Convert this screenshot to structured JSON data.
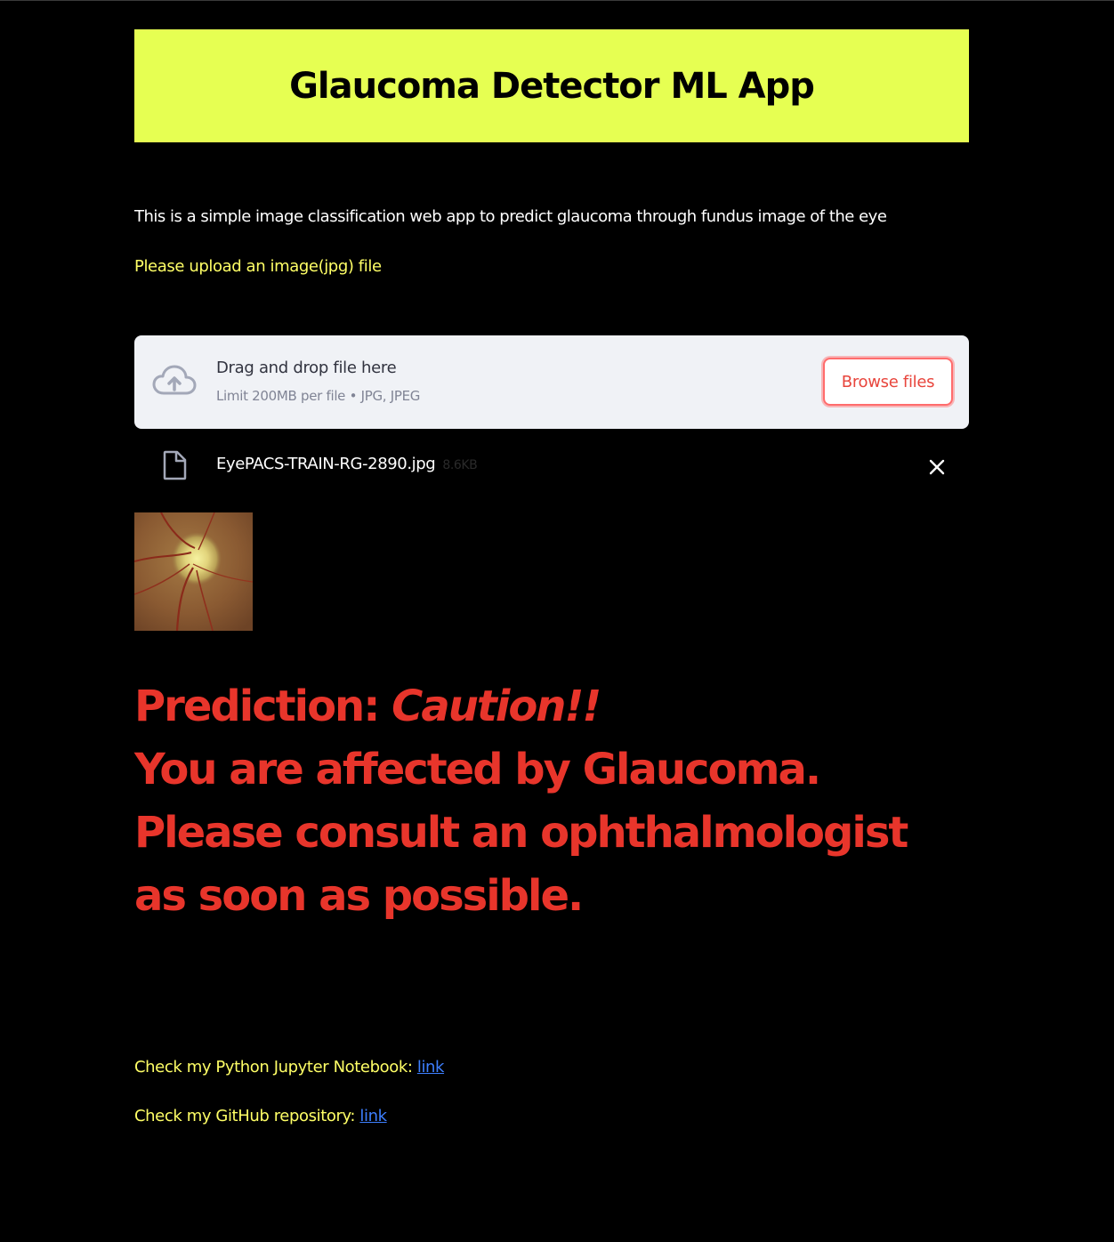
{
  "header": {
    "title": "Glaucoma Detector ML App"
  },
  "intro": {
    "text": "This is a simple image classification web app to predict glaucoma through fundus image of the eye"
  },
  "upload": {
    "prompt": "Please upload an image(jpg) file",
    "dropzone_title": "Drag and drop file here",
    "dropzone_limit": "Limit 200MB per file • JPG, JPEG",
    "browse_label": "Browse files"
  },
  "file": {
    "name": "EyePACS-TRAIN-RG-2890.jpg",
    "size": "8.6KB"
  },
  "prediction": {
    "prefix": "Prediction: ",
    "status": "Caution!!",
    "line2": "You are affected by Glaucoma.",
    "line3": "Please consult an ophthalmologist as soon as possible."
  },
  "footer": {
    "notebook_label": "Check my Python Jupyter Notebook: ",
    "notebook_link": "link",
    "github_label": "Check my GitHub repository: ",
    "github_link": "link"
  },
  "colors": {
    "header_bg": "#e6ff52",
    "accent_yellow": "#ffff66",
    "prediction_red": "#e8352b",
    "link_blue": "#3d7fff",
    "browse_red": "#e8453c"
  },
  "icons": {
    "upload": "cloud-upload-icon",
    "file": "file-icon",
    "close": "close-icon"
  }
}
